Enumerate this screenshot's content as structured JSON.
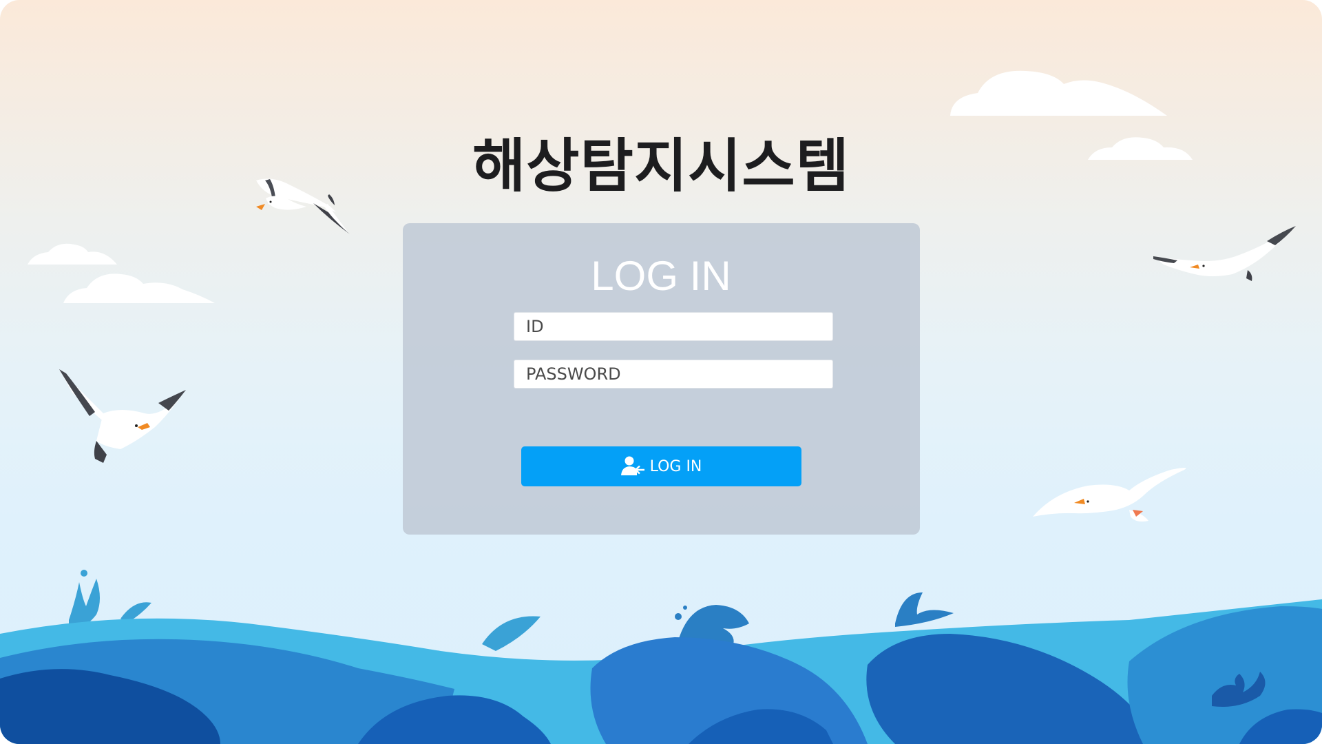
{
  "app": {
    "title": "해상탐지시스템"
  },
  "login": {
    "heading": "LOG IN",
    "id_placeholder": "ID",
    "password_placeholder": "PASSWORD",
    "button_label": "LOG IN",
    "button_icon": "user-login-icon"
  },
  "colors": {
    "button": "#04a0f7",
    "panel": "#c3cdd8",
    "title": "#1d1d1f",
    "sea_light": "#3bb8e6",
    "sea_mid": "#1d7fcd",
    "sea_dark": "#0f4fa3"
  },
  "decorations": {
    "bird_icon": "seagull-icon",
    "cloud_icon": "cloud-icon",
    "wave_icon": "sea-waves"
  }
}
